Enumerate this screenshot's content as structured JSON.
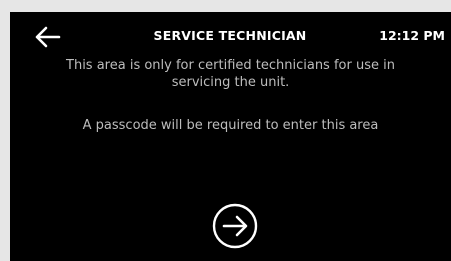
{
  "header": {
    "back_icon": "arrow-left-icon",
    "title": "SERVICE TECHNICIAN",
    "time": "12:12 PM"
  },
  "main": {
    "message_line1": "This area is only for certified technicians for use in",
    "message_line2": "servicing the unit.",
    "passcode_notice": "A passcode will be required to enter this area",
    "next_icon": "arrow-right-circle-icon"
  },
  "colors": {
    "background": "#000000",
    "text_primary": "#ffffff",
    "text_secondary": "#bdbdbd",
    "frame": "#e6e6e6"
  }
}
